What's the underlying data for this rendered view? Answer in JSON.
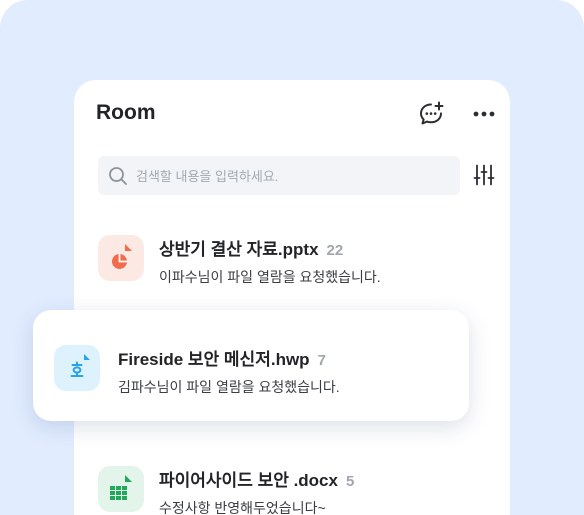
{
  "room": {
    "title": "Room",
    "search_placeholder": "검색할 내용을 입력하세요."
  },
  "files": [
    {
      "name": "상반기 결산 자료.pptx",
      "count": "22",
      "subtitle": "이파수님이 파일 열람을 요청했습니다.",
      "icon": "pptx-file-icon",
      "color": "#f26b4b"
    },
    {
      "name": "Fireside 보안 메신저.hwp",
      "count": "7",
      "subtitle": "김파수님이 파일 열람을 요청했습니다.",
      "icon": "hwp-file-icon",
      "color": "#28a3e8"
    },
    {
      "name": "파이어사이드 보안 .docx",
      "count": "5",
      "subtitle": "수정사항 반영해두었습니다~",
      "icon": "xlsx-file-icon",
      "color": "#22a85a"
    }
  ],
  "colors": {
    "background": "#e1ecff",
    "panel": "#ffffff"
  }
}
